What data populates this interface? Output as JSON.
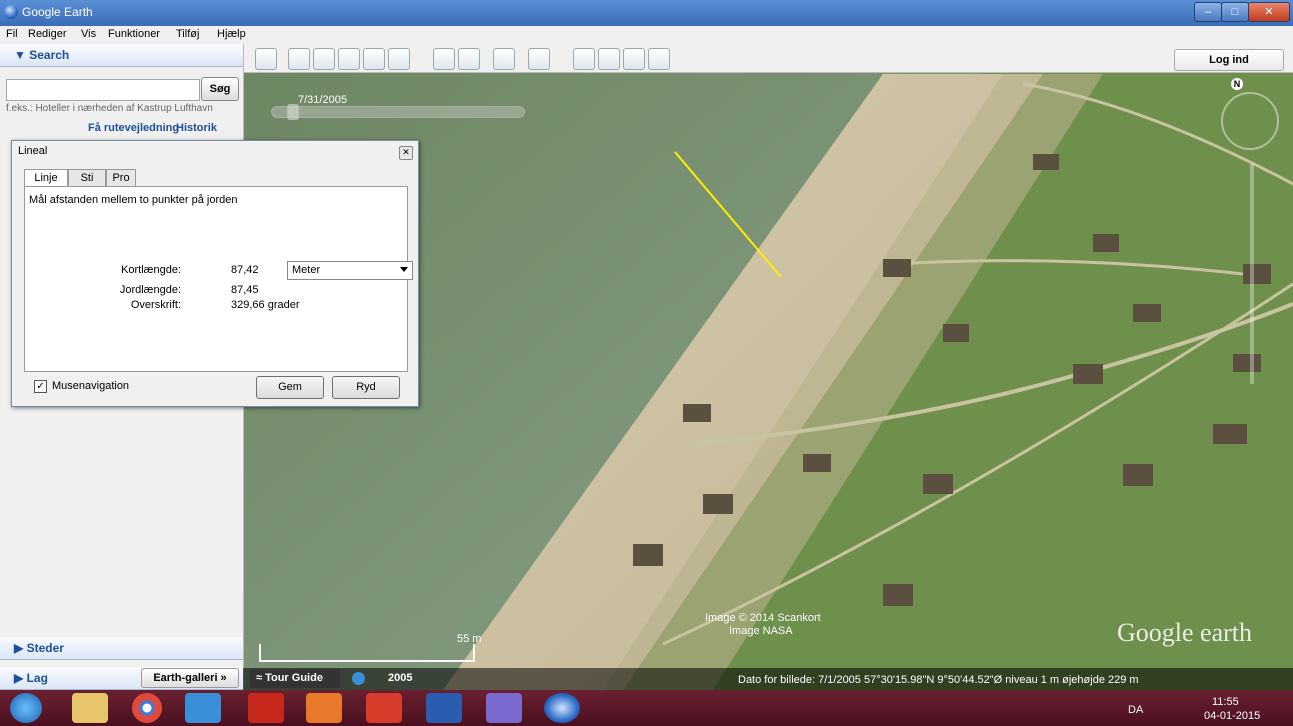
{
  "window": {
    "title": "Google Earth",
    "min": "–",
    "max": "□",
    "close": "✕"
  },
  "menu": [
    "Fil",
    "Rediger",
    "Vis",
    "Funktioner",
    "Tilføj",
    "Hjælp"
  ],
  "sidebar": {
    "search_header": "▼ Search",
    "search_button": "Søg",
    "search_value": "",
    "search_hint": "f.eks.: Hoteller i nærheden af Kastrup Lufthavn",
    "route_link": "Få rutevejledning",
    "history_link": "Historik",
    "places_header": "▶ Steder",
    "layers_header": "▶ Lag",
    "gallery_button": "Earth-galleri »"
  },
  "toolbar": {
    "login": "Log ind"
  },
  "timeline": {
    "date": "7/31/2005"
  },
  "compass": {
    "north": "N"
  },
  "ruler": {
    "title": "Lineal",
    "close": "✕",
    "tabs": [
      "Linje",
      "Sti",
      "Pro"
    ],
    "description": "Mål afstanden mellem to punkter på jorden",
    "map_length_label": "Kortlængde:",
    "map_length_value": "87,42",
    "unit": "Meter",
    "ground_length_label": "Jordlængde:",
    "ground_length_value": "87,45",
    "heading_label": "Overskrift:",
    "heading_value": "329,66 grader",
    "mouse_nav_label": "Musenavigation",
    "mouse_nav_check": "✓",
    "save_button": "Gem",
    "clear_button": "Ryd"
  },
  "map": {
    "copyright1": "Image © 2014 Scankort",
    "copyright2": "Image NASA",
    "logo": "Google earth",
    "scale": "55 m"
  },
  "bottom": {
    "tour_guide": "≈ Tour Guide",
    "year": "2005",
    "status": "Dato for billede: 7/1/2005     57°30'15.98\"N   9°50'44.52\"Ø  niveau    1 m   øjehøjde    229 m"
  },
  "tray": {
    "lang": "DA",
    "time": "11:55",
    "date": "04-01-2015"
  }
}
